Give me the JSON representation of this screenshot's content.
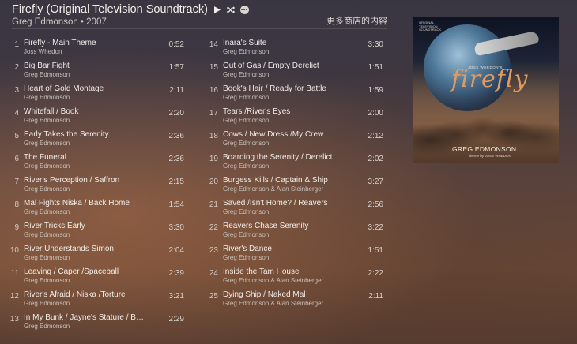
{
  "album": {
    "title": "Firefly (Original Television Soundtrack)",
    "artist_year": "Greg Edmonson • 2007",
    "store_link": "更多商店的内容"
  },
  "controls": {
    "play_icon": "play-icon",
    "shuffle_icon": "shuffle-icon",
    "more_icon": "more-icon"
  },
  "tracks_left": [
    {
      "num": "1",
      "title": "Firefly - Main Theme",
      "artist": "Joss Whedon",
      "duration": "0:52"
    },
    {
      "num": "2",
      "title": "Big Bar Fight",
      "artist": "Greg Edmonson",
      "duration": "1:57"
    },
    {
      "num": "3",
      "title": "Heart of Gold Montage",
      "artist": "Greg Edmonson",
      "duration": "2:11"
    },
    {
      "num": "4",
      "title": "Whitefall / Book",
      "artist": "Greg Edmonson",
      "duration": "2:20"
    },
    {
      "num": "5",
      "title": "Early Takes the Serenity",
      "artist": "Greg Edmonson",
      "duration": "2:36"
    },
    {
      "num": "6",
      "title": "The Funeral",
      "artist": "Greg Edmonson",
      "duration": "2:36"
    },
    {
      "num": "7",
      "title": "River's Perception / Saffron",
      "artist": "Greg Edmonson",
      "duration": "2:15"
    },
    {
      "num": "8",
      "title": "Mal Fights Niska / Back Home",
      "artist": "Greg Edmonson",
      "duration": "1:54"
    },
    {
      "num": "9",
      "title": "River Tricks Early",
      "artist": "Greg Edmonson",
      "duration": "3:30"
    },
    {
      "num": "10",
      "title": "River Understands Simon",
      "artist": "Greg Edmonson",
      "duration": "2:04"
    },
    {
      "num": "11",
      "title": "Leaving / Caper /Spaceball",
      "artist": "Greg Edmonson",
      "duration": "2:39"
    },
    {
      "num": "12",
      "title": "River's Afraid / Niska /Torture",
      "artist": "Greg Edmonson",
      "duration": "3:21"
    },
    {
      "num": "13",
      "title": "In My Bunk / Jayne's Stature / B…",
      "artist": "Greg Edmonson",
      "duration": "2:29"
    }
  ],
  "tracks_right": [
    {
      "num": "14",
      "title": "Inara's Suite",
      "artist": "Greg Edmonson",
      "duration": "3:30"
    },
    {
      "num": "15",
      "title": "Out of Gas / Empty Derelict",
      "artist": "Greg Edmonson",
      "duration": "1:51"
    },
    {
      "num": "16",
      "title": "Book's Hair / Ready for Battle",
      "artist": "Greg Edmonson",
      "duration": "1:59"
    },
    {
      "num": "17",
      "title": "Tears /River's Eyes",
      "artist": "Greg Edmonson",
      "duration": "2:00"
    },
    {
      "num": "18",
      "title": "Cows / New Dress /My Crew",
      "artist": "Greg Edmonson",
      "duration": "2:12"
    },
    {
      "num": "19",
      "title": "Boarding the Serenity / Derelict",
      "artist": "Greg Edmonson",
      "duration": "2:02"
    },
    {
      "num": "20",
      "title": "Burgess Kills / Captain & Ship",
      "artist": "Greg Edmonson & Alan Steinberger",
      "duration": "3:27"
    },
    {
      "num": "21",
      "title": "Saved /Isn't Home? / Reavers",
      "artist": "Greg Edmonson",
      "duration": "2:56"
    },
    {
      "num": "22",
      "title": "Reavers Chase Serenity",
      "artist": "Greg Edmonson",
      "duration": "3:22"
    },
    {
      "num": "23",
      "title": "River's Dance",
      "artist": "Greg Edmonson",
      "duration": "1:51"
    },
    {
      "num": "24",
      "title": "Inside the Tam House",
      "artist": "Greg Edmonson & Alan Steinberger",
      "duration": "2:22"
    },
    {
      "num": "25",
      "title": "Dying Ship / Naked Mal",
      "artist": "Greg Edmonson & Alan Steinberger",
      "duration": "2:11"
    }
  ],
  "cover": {
    "small_text": "ORIGINAL TELEVISION SOUNDTRACK",
    "joss": "JOSS WHEDON'S",
    "logo": "firefly",
    "music_by": "GREG EDMONSON",
    "theme_by": "Theme by JOSS WHEDON"
  }
}
